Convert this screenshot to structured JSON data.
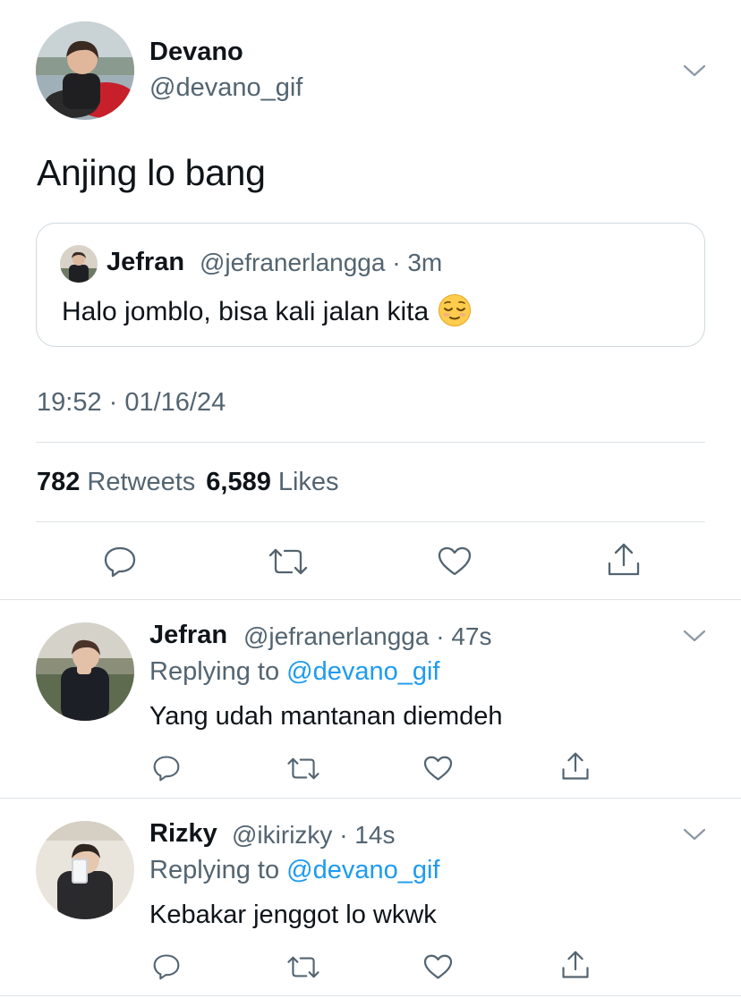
{
  "main_tweet": {
    "display_name": "Devano",
    "handle": "@devano_gif",
    "text": "Anjing lo bang",
    "timestamp": "19:52 · 01/16/24",
    "stats": {
      "retweets_count": "782",
      "retweets_label": "Retweets",
      "likes_count": "6,589",
      "likes_label": "Likes"
    }
  },
  "quoted_tweet": {
    "display_name": "Jefran",
    "meta": "@jefranerlangga · 3m",
    "text": "Halo jomblo, bisa kali jalan kita",
    "emoji": "relieved-face"
  },
  "replies": [
    {
      "display_name": "Jefran",
      "meta": "@jefranerlangga · 47s",
      "replying_prefix": "Replying to ",
      "replying_handle": "@devano_gif",
      "text": "Yang udah mantanan diemdeh"
    },
    {
      "display_name": "Rizky",
      "meta": "@ikirizky · 14s",
      "replying_prefix": "Replying to ",
      "replying_handle": "@devano_gif",
      "text": "Kebakar jenggot lo wkwk"
    }
  ],
  "icons": [
    "reply-icon",
    "retweet-icon",
    "like-icon",
    "share-icon",
    "chevron-down-icon"
  ],
  "colors": {
    "text_primary": "#0f1419",
    "text_secondary": "#536471",
    "link": "#1d9bf0",
    "divider": "#dfe3e6"
  }
}
